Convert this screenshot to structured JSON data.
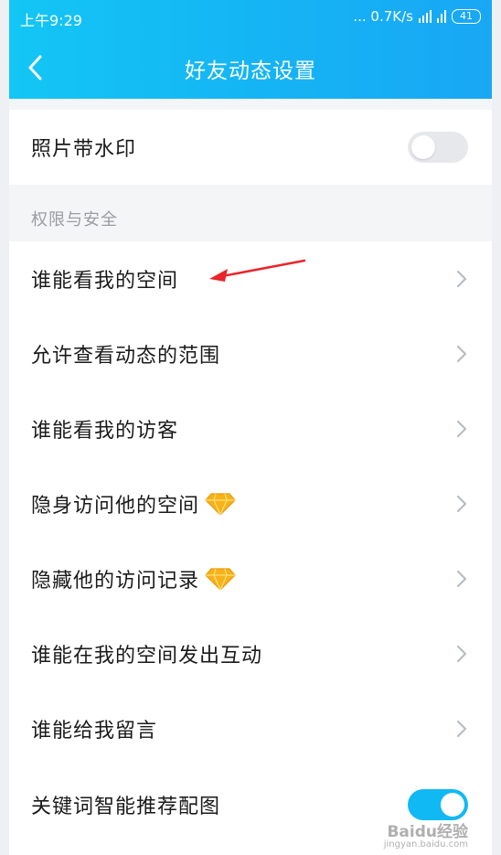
{
  "status_bar": {
    "time": "上午9:29",
    "network_speed": "... 0.7K/s",
    "battery_level": "41"
  },
  "nav": {
    "title": "好友动态设置",
    "back_icon": "chevron-left-icon"
  },
  "photo_watermark": {
    "label": "照片带水印",
    "enabled": false
  },
  "section": {
    "title": "权限与安全"
  },
  "menu_items": [
    {
      "label": "谁能看我的空间"
    },
    {
      "label": "允许查看动态的范围"
    },
    {
      "label": "谁能看我的访客"
    },
    {
      "label": "隐身访问他的空间",
      "badge_icon": "diamond-icon"
    },
    {
      "label": "隐藏他的访问记录",
      "badge_icon": "diamond-icon"
    },
    {
      "label": "谁能在我的空间发出互动"
    },
    {
      "label": "谁能给我留言"
    }
  ],
  "keyword_recommend": {
    "label": "关键词智能推荐配图",
    "enabled": true
  },
  "watermark": {
    "brand": "Baidu经验",
    "url": "jingyan.baidu.com"
  },
  "colors": {
    "header_gradient_start": "#13c6f5",
    "header_gradient_end": "#18a7f4",
    "toggle_on": "#11b9f4",
    "annotation_arrow": "#e8262b",
    "diamond": "#f7b21a"
  }
}
